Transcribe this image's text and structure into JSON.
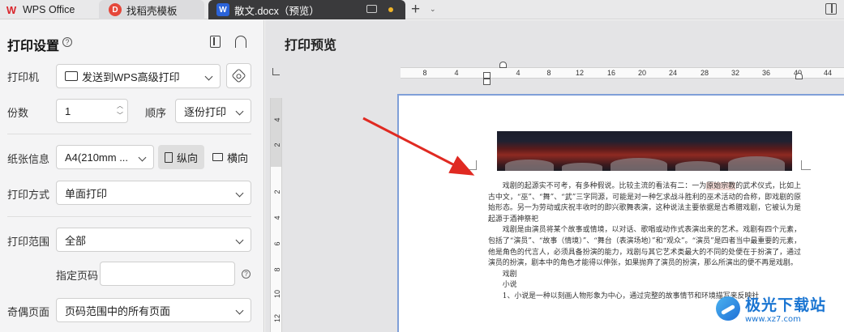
{
  "tabs": {
    "wps_label": "WPS Office",
    "template_label": "找稻壳模板",
    "doc_label": "散文.docx（预览）",
    "add_symbol": "+"
  },
  "settings": {
    "title": "打印设置",
    "printer_label": "打印机",
    "printer_value": "发送到WPS高级打印",
    "copies_label": "份数",
    "copies_value": "1",
    "order_label": "顺序",
    "order_value": "逐份打印",
    "paper_label": "纸张信息",
    "paper_value": "A4(210mm ...",
    "portrait_label": "纵向",
    "landscape_label": "横向",
    "method_label": "打印方式",
    "method_value": "单面打印",
    "range_label": "打印范围",
    "range_value": "全部",
    "pages_label": "指定页码",
    "pages_value": "",
    "oddeven_label": "奇偶页面",
    "oddeven_value": "页码范围中的所有页面"
  },
  "preview": {
    "title": "打印预览",
    "ruler_h": [
      "8",
      "4",
      "4",
      "8",
      "12",
      "16",
      "20",
      "24",
      "28",
      "32",
      "36",
      "40",
      "44"
    ],
    "ruler_v": [
      "4",
      "2",
      "2",
      "4",
      "6",
      "8",
      "10",
      "12"
    ]
  },
  "document": {
    "p1_a": "戏剧的起源实不可考，有多种假说。比较主流的看法有二：一为",
    "p1_hl": "原始宗教",
    "p1_b": "的武术仪式，比如上古中文，“巫”、“舞”、“武”三字同源，可能是对一种乞求战斗胜利的巫术活动的合称，即戏剧的原始形态。另一为劳动或庆祝丰收时的即兴歌舞表演，这种说法主要依据是古希腊戏剧，它被认为是起源于酒神祭祀",
    "p2": "戏剧是由演员将某个故事或情境，以对话、歌唱或动作式表演出来的艺术。戏剧有四个元素，包括了“演员”、“故事（情境）”、“舞台（表演场地）”和“观众”。“演员”是四者当中最重要的元素，他是角色的代言人，必须具备扮演的能力，戏剧与其它艺术类最大的不同的处便在于扮演了，通过演员的扮演，剧本中的角色才能得以伸张，如果抛弃了演员的扮演，那么所演出的便不再是戏剧。",
    "p3": "戏剧",
    "p4": "小说",
    "p5": "1、小说是一种以刻画人物形象为中心，通过完整的故事情节和环境描写来反映社"
  },
  "watermark": {
    "title": "极光下载站",
    "url": "www.xz7.com"
  }
}
